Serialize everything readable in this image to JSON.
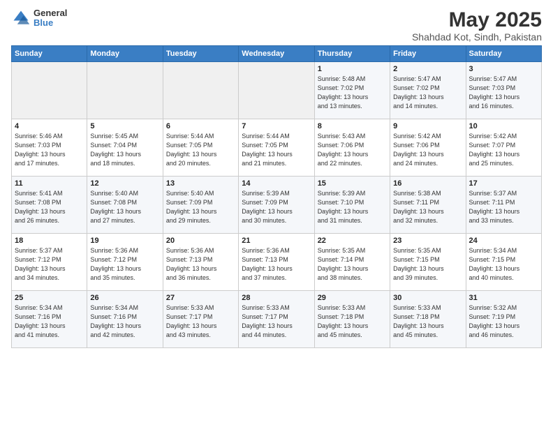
{
  "logo": {
    "general": "General",
    "blue": "Blue"
  },
  "header": {
    "month": "May 2025",
    "location": "Shahdad Kot, Sindh, Pakistan"
  },
  "weekdays": [
    "Sunday",
    "Monday",
    "Tuesday",
    "Wednesday",
    "Thursday",
    "Friday",
    "Saturday"
  ],
  "weeks": [
    [
      {
        "day": "",
        "info": ""
      },
      {
        "day": "",
        "info": ""
      },
      {
        "day": "",
        "info": ""
      },
      {
        "day": "",
        "info": ""
      },
      {
        "day": "1",
        "info": "Sunrise: 5:48 AM\nSunset: 7:02 PM\nDaylight: 13 hours\nand 13 minutes."
      },
      {
        "day": "2",
        "info": "Sunrise: 5:47 AM\nSunset: 7:02 PM\nDaylight: 13 hours\nand 14 minutes."
      },
      {
        "day": "3",
        "info": "Sunrise: 5:47 AM\nSunset: 7:03 PM\nDaylight: 13 hours\nand 16 minutes."
      }
    ],
    [
      {
        "day": "4",
        "info": "Sunrise: 5:46 AM\nSunset: 7:03 PM\nDaylight: 13 hours\nand 17 minutes."
      },
      {
        "day": "5",
        "info": "Sunrise: 5:45 AM\nSunset: 7:04 PM\nDaylight: 13 hours\nand 18 minutes."
      },
      {
        "day": "6",
        "info": "Sunrise: 5:44 AM\nSunset: 7:05 PM\nDaylight: 13 hours\nand 20 minutes."
      },
      {
        "day": "7",
        "info": "Sunrise: 5:44 AM\nSunset: 7:05 PM\nDaylight: 13 hours\nand 21 minutes."
      },
      {
        "day": "8",
        "info": "Sunrise: 5:43 AM\nSunset: 7:06 PM\nDaylight: 13 hours\nand 22 minutes."
      },
      {
        "day": "9",
        "info": "Sunrise: 5:42 AM\nSunset: 7:06 PM\nDaylight: 13 hours\nand 24 minutes."
      },
      {
        "day": "10",
        "info": "Sunrise: 5:42 AM\nSunset: 7:07 PM\nDaylight: 13 hours\nand 25 minutes."
      }
    ],
    [
      {
        "day": "11",
        "info": "Sunrise: 5:41 AM\nSunset: 7:08 PM\nDaylight: 13 hours\nand 26 minutes."
      },
      {
        "day": "12",
        "info": "Sunrise: 5:40 AM\nSunset: 7:08 PM\nDaylight: 13 hours\nand 27 minutes."
      },
      {
        "day": "13",
        "info": "Sunrise: 5:40 AM\nSunset: 7:09 PM\nDaylight: 13 hours\nand 29 minutes."
      },
      {
        "day": "14",
        "info": "Sunrise: 5:39 AM\nSunset: 7:09 PM\nDaylight: 13 hours\nand 30 minutes."
      },
      {
        "day": "15",
        "info": "Sunrise: 5:39 AM\nSunset: 7:10 PM\nDaylight: 13 hours\nand 31 minutes."
      },
      {
        "day": "16",
        "info": "Sunrise: 5:38 AM\nSunset: 7:11 PM\nDaylight: 13 hours\nand 32 minutes."
      },
      {
        "day": "17",
        "info": "Sunrise: 5:37 AM\nSunset: 7:11 PM\nDaylight: 13 hours\nand 33 minutes."
      }
    ],
    [
      {
        "day": "18",
        "info": "Sunrise: 5:37 AM\nSunset: 7:12 PM\nDaylight: 13 hours\nand 34 minutes."
      },
      {
        "day": "19",
        "info": "Sunrise: 5:36 AM\nSunset: 7:12 PM\nDaylight: 13 hours\nand 35 minutes."
      },
      {
        "day": "20",
        "info": "Sunrise: 5:36 AM\nSunset: 7:13 PM\nDaylight: 13 hours\nand 36 minutes."
      },
      {
        "day": "21",
        "info": "Sunrise: 5:36 AM\nSunset: 7:13 PM\nDaylight: 13 hours\nand 37 minutes."
      },
      {
        "day": "22",
        "info": "Sunrise: 5:35 AM\nSunset: 7:14 PM\nDaylight: 13 hours\nand 38 minutes."
      },
      {
        "day": "23",
        "info": "Sunrise: 5:35 AM\nSunset: 7:15 PM\nDaylight: 13 hours\nand 39 minutes."
      },
      {
        "day": "24",
        "info": "Sunrise: 5:34 AM\nSunset: 7:15 PM\nDaylight: 13 hours\nand 40 minutes."
      }
    ],
    [
      {
        "day": "25",
        "info": "Sunrise: 5:34 AM\nSunset: 7:16 PM\nDaylight: 13 hours\nand 41 minutes."
      },
      {
        "day": "26",
        "info": "Sunrise: 5:34 AM\nSunset: 7:16 PM\nDaylight: 13 hours\nand 42 minutes."
      },
      {
        "day": "27",
        "info": "Sunrise: 5:33 AM\nSunset: 7:17 PM\nDaylight: 13 hours\nand 43 minutes."
      },
      {
        "day": "28",
        "info": "Sunrise: 5:33 AM\nSunset: 7:17 PM\nDaylight: 13 hours\nand 44 minutes."
      },
      {
        "day": "29",
        "info": "Sunrise: 5:33 AM\nSunset: 7:18 PM\nDaylight: 13 hours\nand 45 minutes."
      },
      {
        "day": "30",
        "info": "Sunrise: 5:33 AM\nSunset: 7:18 PM\nDaylight: 13 hours\nand 45 minutes."
      },
      {
        "day": "31",
        "info": "Sunrise: 5:32 AM\nSunset: 7:19 PM\nDaylight: 13 hours\nand 46 minutes."
      }
    ]
  ]
}
